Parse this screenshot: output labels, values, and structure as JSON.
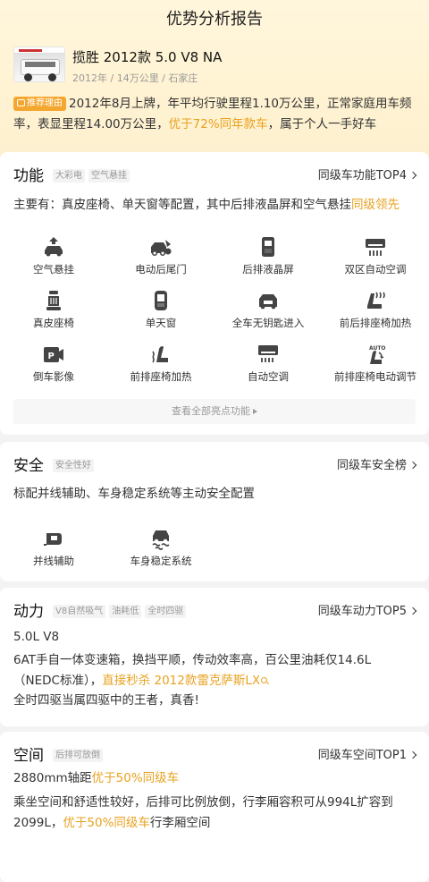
{
  "page_title": "优势分析报告",
  "car": {
    "name": "揽胜 2012款 5.0 V8 NA",
    "meta": "2012年 / 14万公里 / 石家庄"
  },
  "reason": {
    "tag": "推荐理由",
    "text_a": "2012年8月上牌，年平均行驶里程1.10万公里，正常家庭用车频率，表显里程14.00万公里，",
    "highlight": "优于72%同年款车",
    "text_b": "，属于个人一手好车"
  },
  "function": {
    "title": "功能",
    "tags": [
      "大彩电",
      "空气悬挂"
    ],
    "rank": "同级车功能TOP4",
    "summary_a": "主要有：真皮座椅、单天窗等配置，其中后排液晶屏和空气悬挂",
    "summary_hl": "同级领先",
    "features": [
      {
        "label": "空气悬挂",
        "icon": "air-suspension-icon"
      },
      {
        "label": "电动后尾门",
        "icon": "power-tailgate-icon"
      },
      {
        "label": "后排液晶屏",
        "icon": "rear-screen-icon"
      },
      {
        "label": "双区自动空调",
        "icon": "dual-zone-ac-icon"
      },
      {
        "label": "真皮座椅",
        "icon": "leather-seat-icon"
      },
      {
        "label": "单天窗",
        "icon": "sunroof-icon"
      },
      {
        "label": "全车无钥匙进入",
        "icon": "keyless-entry-icon"
      },
      {
        "label": "前后排座椅加热",
        "icon": "seat-heating-icon"
      },
      {
        "label": "倒车影像",
        "icon": "reverse-camera-icon"
      },
      {
        "label": "前排座椅加热",
        "icon": "front-seat-heating-icon"
      },
      {
        "label": "自动空调",
        "icon": "auto-ac-icon"
      },
      {
        "label": "前排座椅电动调节",
        "icon": "power-seat-icon"
      }
    ],
    "more": "查看全部亮点功能"
  },
  "safety": {
    "title": "安全",
    "tags": [
      "安全性好"
    ],
    "rank": "同级车安全榜",
    "summary": "标配并线辅助、车身稳定系统等主动安全配置",
    "features": [
      {
        "label": "并线辅助",
        "icon": "lane-assist-icon"
      },
      {
        "label": "车身稳定系统",
        "icon": "stability-control-icon"
      }
    ]
  },
  "power": {
    "title": "动力",
    "tags": [
      "V8自然吸气",
      "油耗低",
      "全时四驱"
    ],
    "rank": "同级车动力TOP5",
    "engine": "5.0L V8",
    "desc": "6AT手自一体变速箱，换挡平顺，传动效率高，百公里油耗仅14.6L（NEDC标准），",
    "hl": "直接秒杀 2012款雷克萨斯LX",
    "tail": "全时四驱当属四驱中的王者，真香!"
  },
  "space": {
    "title": "空间",
    "tags": [
      "后排可放倒"
    ],
    "rank": "同级车空间TOP1",
    "wheelbase": "2880mm轴距",
    "wheelbase_hl": "优于50%同级车",
    "desc_a": "乘坐空间和舒适性较好，后排可比例放倒，行李厢容积可从994L扩容到2099L，",
    "desc_hl": "优于50%同级车",
    "desc_b": "行李厢空间"
  },
  "colors": {
    "accent": "#e8a220",
    "tag_bg": "#f4a72f",
    "header_bg": "#fff3d3"
  }
}
